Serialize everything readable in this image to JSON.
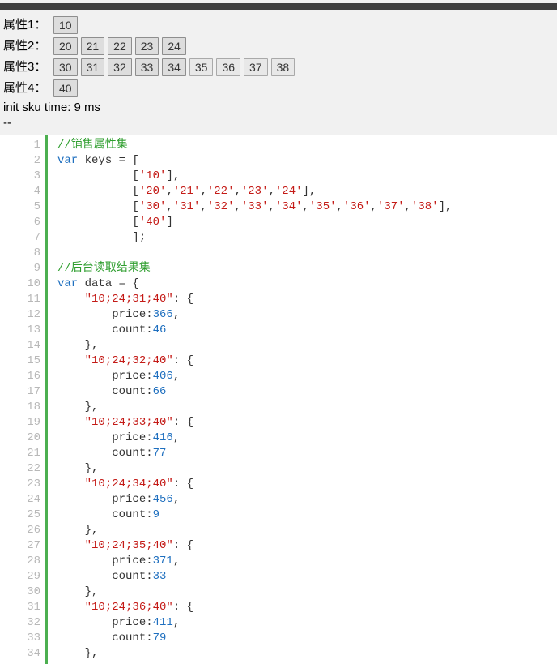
{
  "attrs": [
    {
      "label": "属性1：",
      "buttons": [
        {
          "v": "10",
          "selected": true
        }
      ]
    },
    {
      "label": "属性2：",
      "buttons": [
        {
          "v": "20",
          "selected": true
        },
        {
          "v": "21",
          "selected": true
        },
        {
          "v": "22",
          "selected": true
        },
        {
          "v": "23",
          "selected": true
        },
        {
          "v": "24",
          "selected": true
        }
      ]
    },
    {
      "label": "属性3：",
      "buttons": [
        {
          "v": "30",
          "selected": true
        },
        {
          "v": "31",
          "selected": true
        },
        {
          "v": "32",
          "selected": true
        },
        {
          "v": "33",
          "selected": true
        },
        {
          "v": "34",
          "selected": true
        },
        {
          "v": "35",
          "selected": false
        },
        {
          "v": "36",
          "selected": false
        },
        {
          "v": "37",
          "selected": false
        },
        {
          "v": "38",
          "selected": false
        }
      ]
    },
    {
      "label": "属性4：",
      "buttons": [
        {
          "v": "40",
          "selected": true
        }
      ]
    }
  ],
  "status_line": "init sku time: 9 ms",
  "dashes": "--",
  "code_lines": [
    [
      {
        "t": "//销售属性集",
        "c": "c-comment"
      }
    ],
    [
      {
        "t": "var",
        "c": "c-kw"
      },
      {
        "t": " keys = ["
      }
    ],
    [
      {
        "t": "           ["
      },
      {
        "t": "'10'",
        "c": "c-str"
      },
      {
        "t": "],"
      }
    ],
    [
      {
        "t": "           ["
      },
      {
        "t": "'20'",
        "c": "c-str"
      },
      {
        "t": ","
      },
      {
        "t": "'21'",
        "c": "c-str"
      },
      {
        "t": ","
      },
      {
        "t": "'22'",
        "c": "c-str"
      },
      {
        "t": ","
      },
      {
        "t": "'23'",
        "c": "c-str"
      },
      {
        "t": ","
      },
      {
        "t": "'24'",
        "c": "c-str"
      },
      {
        "t": "],"
      }
    ],
    [
      {
        "t": "           ["
      },
      {
        "t": "'30'",
        "c": "c-str"
      },
      {
        "t": ","
      },
      {
        "t": "'31'",
        "c": "c-str"
      },
      {
        "t": ","
      },
      {
        "t": "'32'",
        "c": "c-str"
      },
      {
        "t": ","
      },
      {
        "t": "'33'",
        "c": "c-str"
      },
      {
        "t": ","
      },
      {
        "t": "'34'",
        "c": "c-str"
      },
      {
        "t": ","
      },
      {
        "t": "'35'",
        "c": "c-str"
      },
      {
        "t": ","
      },
      {
        "t": "'36'",
        "c": "c-str"
      },
      {
        "t": ","
      },
      {
        "t": "'37'",
        "c": "c-str"
      },
      {
        "t": ","
      },
      {
        "t": "'38'",
        "c": "c-str"
      },
      {
        "t": "],"
      }
    ],
    [
      {
        "t": "           ["
      },
      {
        "t": "'40'",
        "c": "c-str"
      },
      {
        "t": "]"
      }
    ],
    [
      {
        "t": "           ];"
      }
    ],
    [
      {
        "t": ""
      }
    ],
    [
      {
        "t": "//后台读取结果集",
        "c": "c-comment"
      }
    ],
    [
      {
        "t": "var",
        "c": "c-kw"
      },
      {
        "t": " data = {"
      }
    ],
    [
      {
        "t": "    "
      },
      {
        "t": "\"10;24;31;40\"",
        "c": "c-str"
      },
      {
        "t": ": {"
      }
    ],
    [
      {
        "t": "        price:"
      },
      {
        "t": "366",
        "c": "c-num"
      },
      {
        "t": ","
      }
    ],
    [
      {
        "t": "        count:"
      },
      {
        "t": "46",
        "c": "c-num"
      }
    ],
    [
      {
        "t": "    },"
      }
    ],
    [
      {
        "t": "    "
      },
      {
        "t": "\"10;24;32;40\"",
        "c": "c-str"
      },
      {
        "t": ": {"
      }
    ],
    [
      {
        "t": "        price:"
      },
      {
        "t": "406",
        "c": "c-num"
      },
      {
        "t": ","
      }
    ],
    [
      {
        "t": "        count:"
      },
      {
        "t": "66",
        "c": "c-num"
      }
    ],
    [
      {
        "t": "    },"
      }
    ],
    [
      {
        "t": "    "
      },
      {
        "t": "\"10;24;33;40\"",
        "c": "c-str"
      },
      {
        "t": ": {"
      }
    ],
    [
      {
        "t": "        price:"
      },
      {
        "t": "416",
        "c": "c-num"
      },
      {
        "t": ","
      }
    ],
    [
      {
        "t": "        count:"
      },
      {
        "t": "77",
        "c": "c-num"
      }
    ],
    [
      {
        "t": "    },"
      }
    ],
    [
      {
        "t": "    "
      },
      {
        "t": "\"10;24;34;40\"",
        "c": "c-str"
      },
      {
        "t": ": {"
      }
    ],
    [
      {
        "t": "        price:"
      },
      {
        "t": "456",
        "c": "c-num"
      },
      {
        "t": ","
      }
    ],
    [
      {
        "t": "        count:"
      },
      {
        "t": "9",
        "c": "c-num"
      }
    ],
    [
      {
        "t": "    },"
      }
    ],
    [
      {
        "t": "    "
      },
      {
        "t": "\"10;24;35;40\"",
        "c": "c-str"
      },
      {
        "t": ": {"
      }
    ],
    [
      {
        "t": "        price:"
      },
      {
        "t": "371",
        "c": "c-num"
      },
      {
        "t": ","
      }
    ],
    [
      {
        "t": "        count:"
      },
      {
        "t": "33",
        "c": "c-num"
      }
    ],
    [
      {
        "t": "    },"
      }
    ],
    [
      {
        "t": "    "
      },
      {
        "t": "\"10;24;36;40\"",
        "c": "c-str"
      },
      {
        "t": ": {"
      }
    ],
    [
      {
        "t": "        price:"
      },
      {
        "t": "411",
        "c": "c-num"
      },
      {
        "t": ","
      }
    ],
    [
      {
        "t": "        count:"
      },
      {
        "t": "79",
        "c": "c-num"
      }
    ],
    [
      {
        "t": "    },"
      }
    ]
  ]
}
